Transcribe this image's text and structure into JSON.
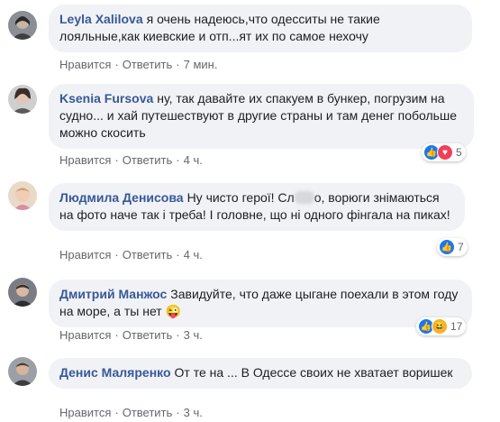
{
  "actions": {
    "like": "Нравится",
    "reply": "Ответить",
    "sep": "·"
  },
  "comments": [
    {
      "author": "Leyla Xalilova",
      "text": "я очень надеюсь,что одесситы не такие лояльные,как киевские и отп...ят их по самое нехочу",
      "time": "7 мин.",
      "reactions": null
    },
    {
      "author": "Ksenia Fursova",
      "text": "ну, так давайте их спакуем в бункер, погрузим на судно... и хай путешествуют в другие страны и там денег побольше можно скосить",
      "time": "4 ч.",
      "reactions": {
        "icons": [
          "like-icon",
          "love-icon"
        ],
        "count": "5"
      }
    },
    {
      "author": "Людмила Денисова",
      "text_before": "Ну чисто герої! Сл",
      "text_after": "о, ворюги знімаються на фото наче так і треба! І головне, що ні одного фінгала на пиках!",
      "time": "4 ч.",
      "reactions": {
        "icons": [
          "like-icon"
        ],
        "count": "7"
      }
    },
    {
      "author": "Дмитрий Манжос",
      "text": "Завидуйте, что даже цыгане поехали в этом году на море, а ты нет",
      "emoji": "😜",
      "time": "3 ч.",
      "reactions": {
        "icons": [
          "like-icon",
          "haha-icon"
        ],
        "count": "17"
      }
    },
    {
      "author": "Денис Маляренко",
      "text": "От те на ... В Одессе своих не хватает воришек",
      "time": "3 ч.",
      "reactions": null
    }
  ],
  "colors": {
    "author": "#385898",
    "bubble": "#f0f2f5",
    "like": "#1877f2",
    "love": "#f33e58",
    "haha": "#f7b125"
  }
}
